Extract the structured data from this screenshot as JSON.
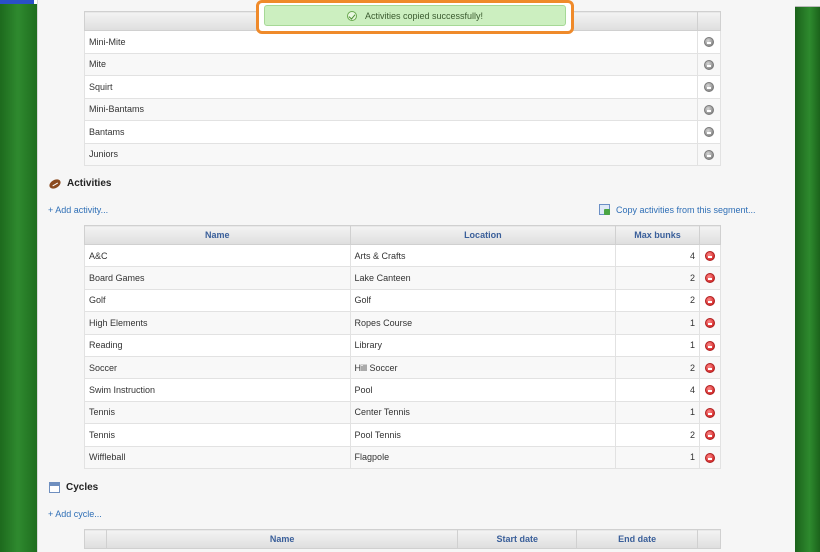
{
  "toast": {
    "message": "Activities copied successfully!"
  },
  "groups": {
    "rows": [
      "Mini-Mite",
      "Mite",
      "Squirt",
      "Mini-Bantams",
      "Bantams",
      "Juniors"
    ]
  },
  "activities": {
    "title": "Activities",
    "add_link": "+ Add activity...",
    "copy_link": "Copy activities from this segment...",
    "headers": {
      "name": "Name",
      "location": "Location",
      "max_bunks": "Max bunks"
    },
    "rows": [
      {
        "name": "A&C",
        "location": "Arts & Crafts",
        "max": "4"
      },
      {
        "name": "Board Games",
        "location": "Lake Canteen",
        "max": "2"
      },
      {
        "name": "Golf",
        "location": "Golf",
        "max": "2"
      },
      {
        "name": "High Elements",
        "location": "Ropes Course",
        "max": "1"
      },
      {
        "name": "Reading",
        "location": "Library",
        "max": "1"
      },
      {
        "name": "Soccer",
        "location": "Hill Soccer",
        "max": "2"
      },
      {
        "name": "Swim Instruction",
        "location": "Pool",
        "max": "4"
      },
      {
        "name": "Tennis",
        "location": "Center Tennis",
        "max": "1"
      },
      {
        "name": "Tennis",
        "location": "Pool Tennis",
        "max": "2"
      },
      {
        "name": "Wiffleball",
        "location": "Flagpole",
        "max": "1"
      }
    ]
  },
  "cycles": {
    "title": "Cycles",
    "add_link": "+ Add cycle...",
    "headers": {
      "name": "Name",
      "start": "Start date",
      "end": "End date"
    }
  },
  "icons": [
    "football-icon",
    "calendar-icon",
    "copy-icon",
    "check-icon",
    "remove-icon"
  ]
}
